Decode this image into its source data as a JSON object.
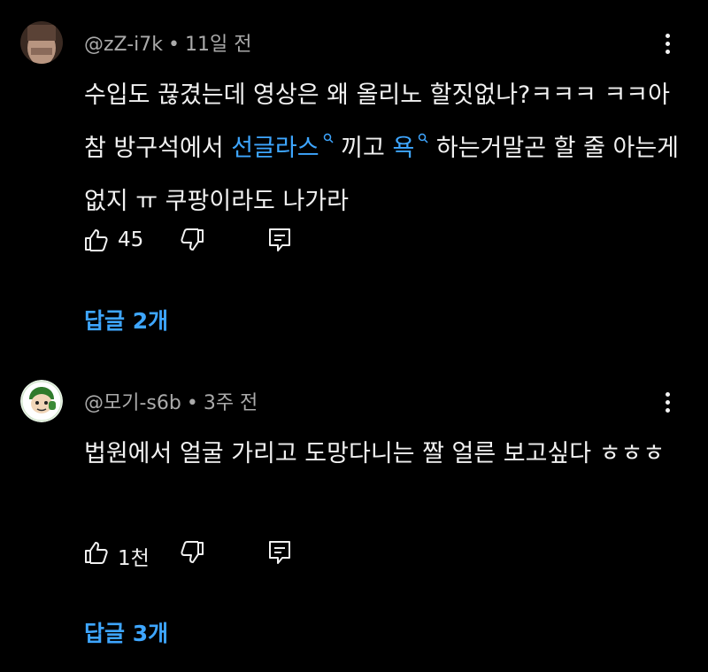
{
  "comments": [
    {
      "author": "@zZ-i7k",
      "time": "11일 전",
      "text_segments": [
        {
          "text": "수입도 끊겼는데 영상은 왜 올리노 할짓없나?ㅋㅋㅋ ㅋㅋ아참 방구석에서 ",
          "link": false
        },
        {
          "text": "선글라스",
          "link": true
        },
        {
          "text": " 끼고 ",
          "link": false
        },
        {
          "text": "욕",
          "link": true
        },
        {
          "text": " 하는거말곤 할 줄 아는게 없지 ㅠ 쿠팡이라도 나가라",
          "link": false
        }
      ],
      "likes": "45",
      "replies_label": "답글 2개"
    },
    {
      "author": "@모기-s6b",
      "time": "3주 전",
      "text_segments": [
        {
          "text": "법원에서 얼굴 가리고 도망다니는 짤 얼른 보고싶다 ㅎㅎㅎ",
          "link": false
        }
      ],
      "likes": "1천",
      "replies_label": "답글 3개"
    }
  ],
  "icons": {
    "like": "thumb-up-icon",
    "dislike": "thumb-down-icon",
    "reply": "reply-icon",
    "more": "more-vert-icon",
    "inline_search": "search-icon"
  },
  "colors": {
    "background": "#000000",
    "text": "#f1f1f1",
    "meta": "#aaaaaa",
    "link": "#3ea6ff"
  }
}
